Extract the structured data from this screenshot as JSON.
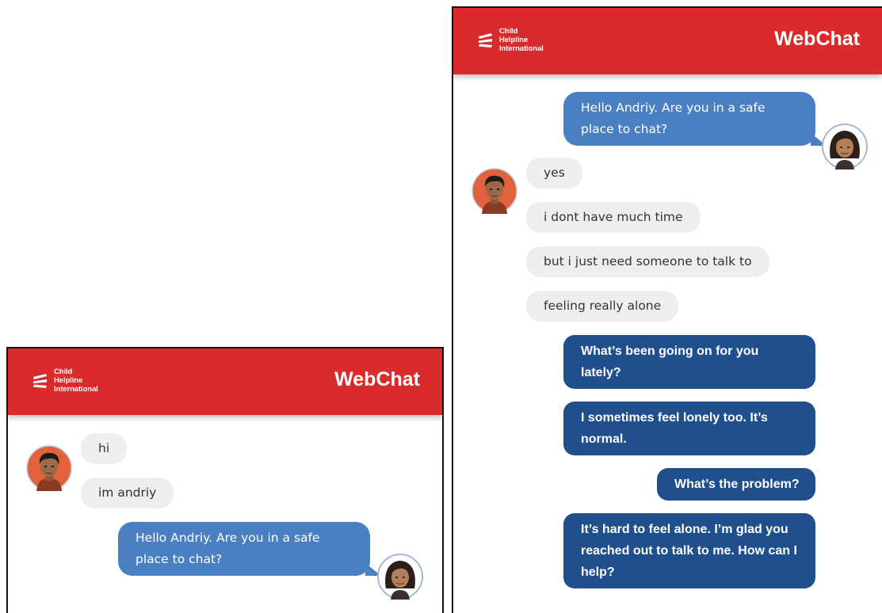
{
  "brand": {
    "logo_lines": [
      "Child",
      "Helpline",
      "International"
    ],
    "title": "WebChat",
    "colors": {
      "header": "#d92b2b",
      "incoming_bubble": "#eeeeee",
      "counselor_bubble": "#4a7fc1",
      "suggested_bubble": "#1f4f8d"
    }
  },
  "avatars": {
    "user": "boy-avatar-icon",
    "counselor": "woman-avatar-icon"
  },
  "left_panel": {
    "messages": [
      {
        "from": "user",
        "text": "hi"
      },
      {
        "from": "user",
        "text": "im andriy"
      },
      {
        "from": "counselor",
        "text": "Hello Andriy. Are you in a safe place to chat?"
      }
    ]
  },
  "right_panel": {
    "messages": [
      {
        "from": "counselor",
        "text": "Hello Andriy. Are you in a safe place to chat?"
      },
      {
        "from": "user",
        "text": "yes"
      },
      {
        "from": "user",
        "text": "i dont have much time"
      },
      {
        "from": "user",
        "text": "but i just need someone to talk to"
      },
      {
        "from": "user",
        "text": "feeling really alone"
      },
      {
        "from": "suggestion",
        "text": "What’s been going on for you lately?"
      },
      {
        "from": "suggestion",
        "text": "I sometimes feel lonely too. It’s normal."
      },
      {
        "from": "suggestion",
        "text": "What’s the problem?"
      },
      {
        "from": "suggestion",
        "text": "It’s hard to feel alone. I’m glad you reached out to talk to me. How can I help?"
      }
    ]
  }
}
